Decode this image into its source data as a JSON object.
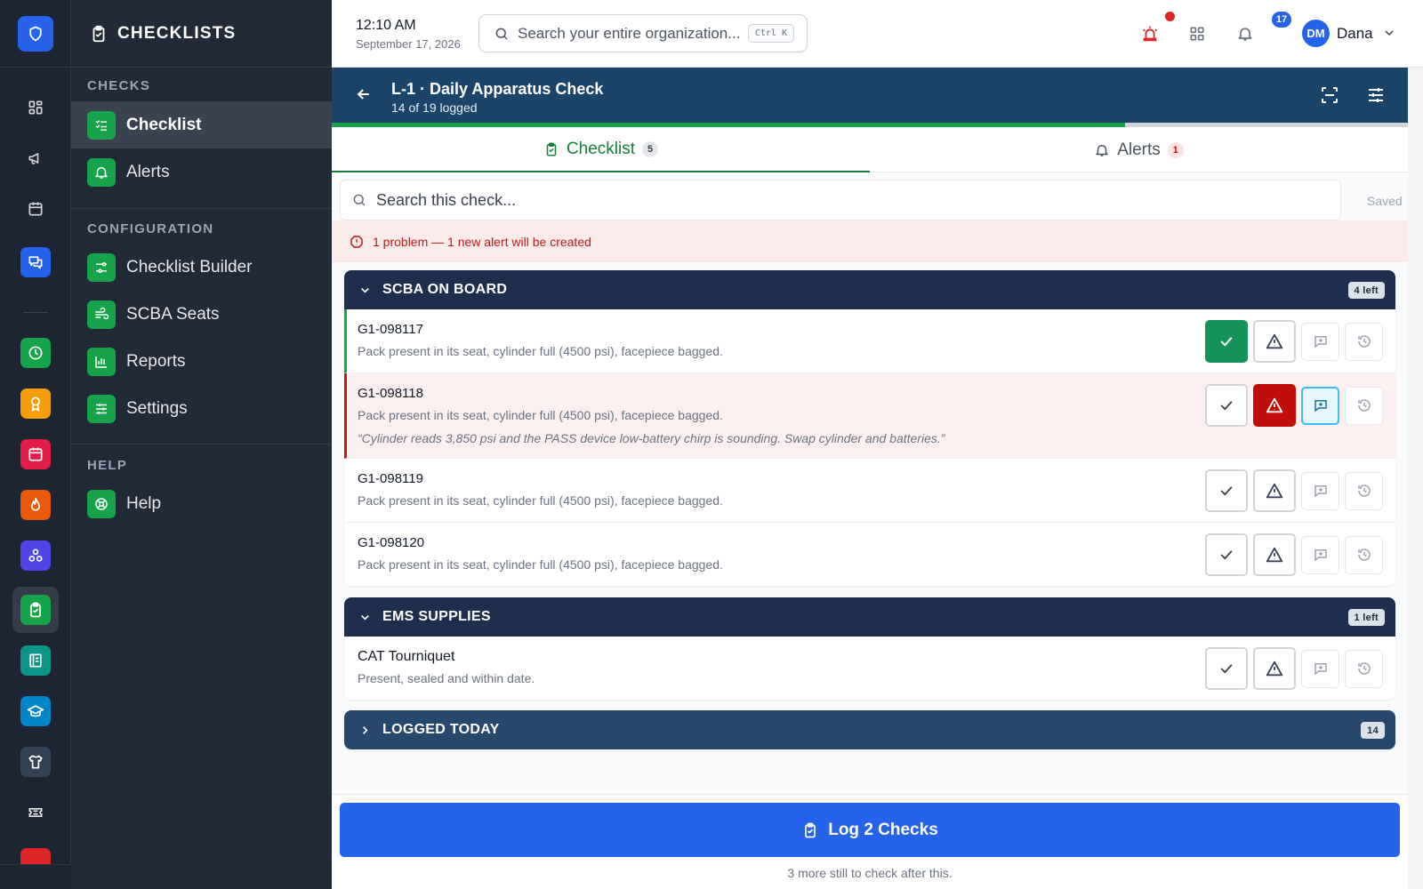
{
  "sidebar": {
    "header": "CHECKLISTS",
    "sections": [
      {
        "title": "CHECKS",
        "items": [
          {
            "label": "Checklist",
            "active": true,
            "icon": "list-check-icon"
          },
          {
            "label": "Alerts",
            "active": false,
            "icon": "bell-icon"
          }
        ]
      },
      {
        "title": "CONFIGURATION",
        "items": [
          {
            "label": "Checklist Builder",
            "icon": "sliders-icon"
          },
          {
            "label": "SCBA Seats",
            "icon": "wind-icon"
          },
          {
            "label": "Reports",
            "icon": "bar-chart-icon"
          },
          {
            "label": "Settings",
            "icon": "settings-sliders-icon"
          }
        ]
      },
      {
        "title": "HELP",
        "items": [
          {
            "label": "Help",
            "icon": "lifebuoy-icon"
          }
        ]
      }
    ]
  },
  "rail": {
    "icons": [
      "shield-icon",
      "dashboard-icon",
      "megaphone-icon",
      "calendar-icon",
      "chat-icon",
      "clock-icon",
      "badge-icon",
      "calendar-red-icon",
      "fire-icon",
      "network-icon",
      "checklist-icon",
      "book-icon",
      "graduation-icon",
      "shirt-icon",
      "ticket-icon",
      "siren-icon"
    ],
    "colors": {
      "accent_blue": "#2563eb",
      "green": "#16a34a",
      "amber": "#f59e0b",
      "rose": "#e11d48",
      "orange": "#ea580c",
      "indigo": "#4f46e5",
      "teal": "#0d9488",
      "sky": "#0284c7"
    }
  },
  "topbar": {
    "time": "12:10 AM",
    "date": "September 17, 2026",
    "search_placeholder": "Search your entire organization...",
    "shortcut": "Ctrl K",
    "notification_count": "17",
    "avatar_initials": "DM",
    "user_name": "Dana"
  },
  "check": {
    "title": "L-1 · Daily Apparatus Check",
    "subtitle": "14 of 19 logged",
    "progress": 0.7368
  },
  "tabs": [
    {
      "label": "Checklist",
      "count": "5",
      "active": true
    },
    {
      "label": "Alerts",
      "count": "1",
      "active": false
    }
  ],
  "content": {
    "search_placeholder": "Search this check...",
    "saved_label": "Saved",
    "problem_text": "1 problem — 1 new alert will be created"
  },
  "sections": [
    {
      "title": "SCBA ON BOARD",
      "badge": "4 left",
      "items": [
        {
          "id": "G1-098117",
          "desc": "Pack present in its seat, cylinder full (4500 psi), facepiece bagged.",
          "status": "ok",
          "note": ""
        },
        {
          "id": "G1-098118",
          "desc": "Pack present in its seat, cylinder full (4500 psi), facepiece bagged.",
          "status": "problem",
          "note": "“Cylinder reads 3,850 psi and the PASS device low-battery chirp is sounding. Swap cylinder and batteries.”"
        },
        {
          "id": "G1-098119",
          "desc": "Pack present in its seat, cylinder full (4500 psi), facepiece bagged.",
          "status": "none",
          "note": ""
        },
        {
          "id": "G1-098120",
          "desc": "Pack present in its seat, cylinder full (4500 psi), facepiece bagged.",
          "status": "none",
          "note": ""
        }
      ]
    },
    {
      "title": "EMS SUPPLIES",
      "badge": "1 left",
      "items": [
        {
          "id": "CAT Tourniquet",
          "desc": "Present, sealed and within date.",
          "status": "none",
          "note": ""
        }
      ]
    },
    {
      "title": "LOGGED TODAY",
      "badge": "14",
      "collapsed": true
    }
  ],
  "footer": {
    "button_label": "Log 2 Checks",
    "note": "3 more still to check after this."
  }
}
